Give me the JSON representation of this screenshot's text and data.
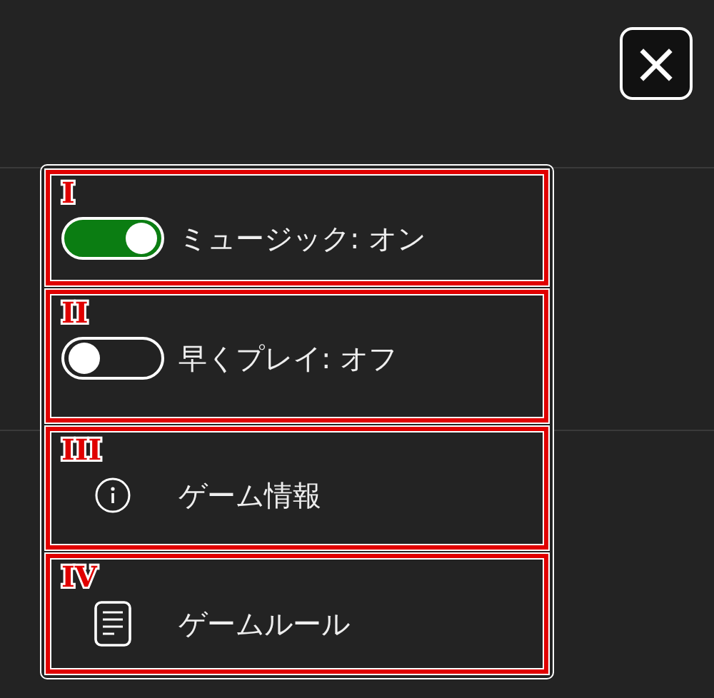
{
  "close_button": {
    "label": "×"
  },
  "menu": {
    "items": [
      {
        "marker": "I",
        "kind": "toggle",
        "on": true,
        "label": "ミュージック: オン"
      },
      {
        "marker": "II",
        "kind": "toggle",
        "on": false,
        "label": "早くプレイ: オフ"
      },
      {
        "marker": "III",
        "kind": "info",
        "label": "ゲーム情報"
      },
      {
        "marker": "IV",
        "kind": "document",
        "label": "ゲームルール"
      }
    ]
  }
}
